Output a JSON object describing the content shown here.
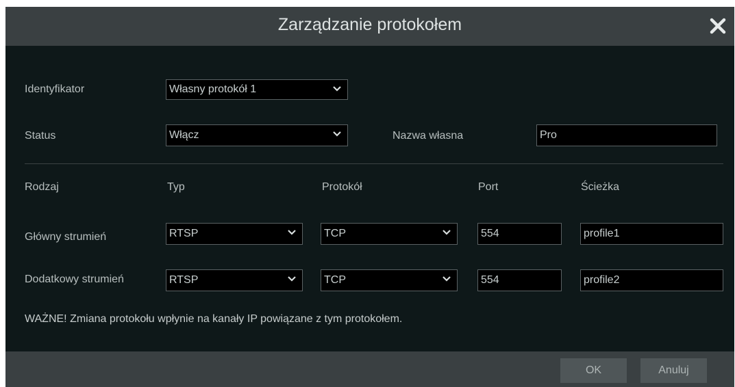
{
  "dialog": {
    "title": "Zarządzanie protokołem"
  },
  "identyfikator": {
    "label": "Identyfikator",
    "value": "Własny protokół 1"
  },
  "status": {
    "label": "Status",
    "value": "Włącz"
  },
  "custom_name": {
    "label": "Nazwa własna",
    "value": "Pro"
  },
  "table": {
    "headers": {
      "rodzaj": "Rodzaj",
      "typ": "Typ",
      "protokol": "Protokół",
      "port": "Port",
      "sciezka": "Ścieżka"
    },
    "rows": [
      {
        "name": "Główny strumień",
        "type": "RTSP",
        "protocol": "TCP",
        "port": "554",
        "path": "profile1"
      },
      {
        "name": "Dodatkowy strumień",
        "type": "RTSP",
        "protocol": "TCP",
        "port": "554",
        "path": "profile2"
      }
    ]
  },
  "note": "WAŻNE! Zmiana protokołu wpłynie na kanały IP powiązane z tym protokołem.",
  "buttons": {
    "ok": "OK",
    "cancel": "Anuluj"
  },
  "icons": {
    "close": "close-icon",
    "dropdown": "chevron-down-icon"
  },
  "colors": {
    "background": "#0e1819",
    "titlebar": "#3a4042",
    "button": "#4f5658"
  }
}
